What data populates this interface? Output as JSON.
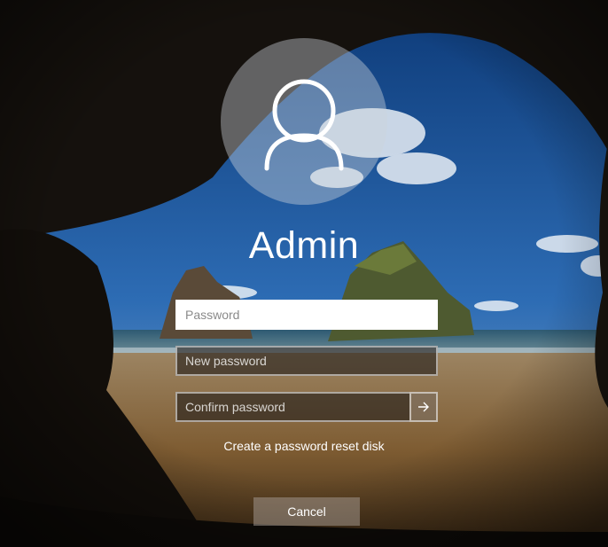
{
  "user": {
    "name": "Admin",
    "avatar_icon": "user-silhouette-icon"
  },
  "form": {
    "password_placeholder": "Password",
    "new_password_placeholder": "New password",
    "confirm_password_placeholder": "Confirm password",
    "submit_icon": "arrow-right-icon"
  },
  "links": {
    "reset_disk": "Create a password reset disk"
  },
  "buttons": {
    "cancel": "Cancel"
  },
  "colors": {
    "sky": "#1a56a0",
    "sand": "#8a6a3c",
    "cave": "#14100c"
  }
}
